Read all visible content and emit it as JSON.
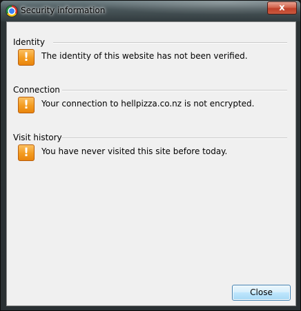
{
  "window": {
    "title": "Security information",
    "close_glyph": "x"
  },
  "sections": [
    {
      "label": "Identity",
      "icon": "warning-icon",
      "message": "The identity of this website has not been verified."
    },
    {
      "label": "Connection",
      "icon": "warning-icon",
      "message": "Your connection to hellpizza.co.nz is not encrypted."
    },
    {
      "label": "Visit history",
      "icon": "warning-icon",
      "message": "You have never visited this site before today."
    }
  ],
  "footer": {
    "close_label": "Close"
  },
  "colors": {
    "warning": "#f39b20",
    "button_border": "#3c7fb1",
    "dialog_bg": "#f0f0f0"
  }
}
